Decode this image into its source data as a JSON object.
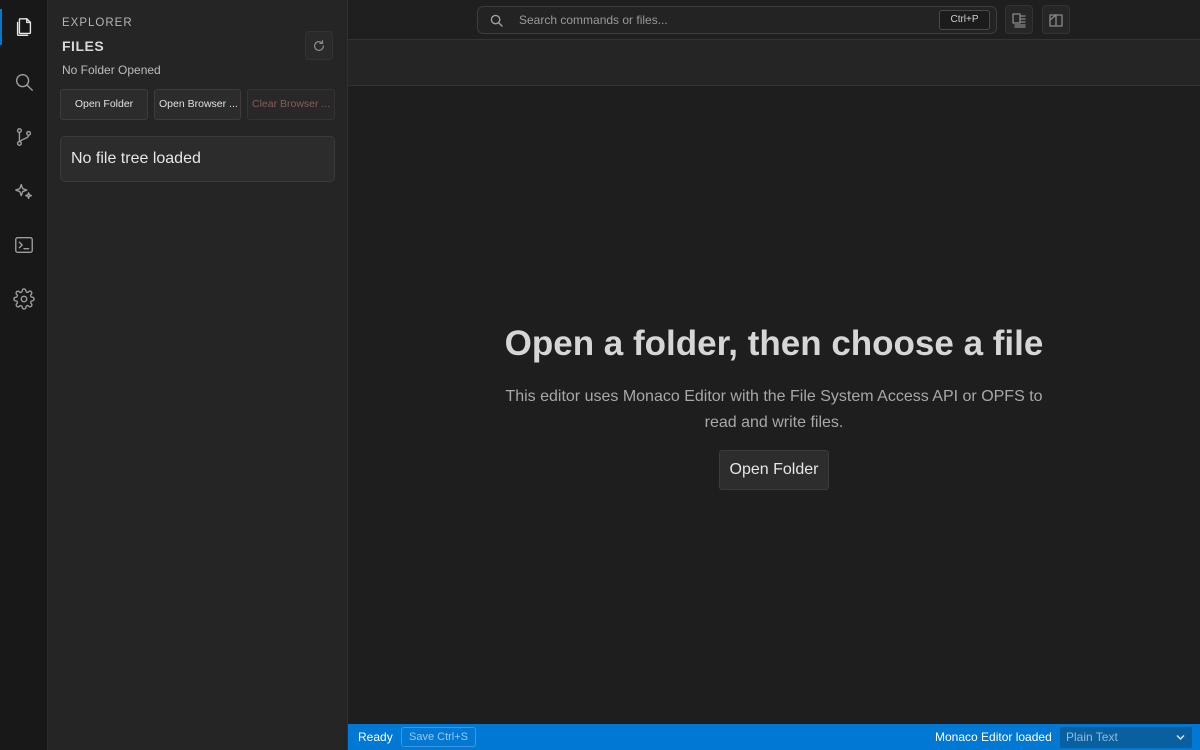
{
  "activity_bar": {
    "items": [
      {
        "name": "explorer",
        "icon": "files-icon",
        "active": true
      },
      {
        "name": "search",
        "icon": "search-icon",
        "active": false
      },
      {
        "name": "source-control",
        "icon": "source-control-icon",
        "active": false
      },
      {
        "name": "ai-assistant",
        "icon": "sparkle-icon",
        "active": false
      },
      {
        "name": "terminal",
        "icon": "terminal-icon",
        "active": false
      },
      {
        "name": "settings",
        "icon": "gear-icon",
        "active": false
      }
    ]
  },
  "sidebar": {
    "section_label": "EXPLORER",
    "title": "FILES",
    "subtitle": "No Folder Opened",
    "refresh_icon": "refresh-icon",
    "buttons": {
      "open_folder": "Open Folder",
      "open_browser": "Open Browser ...",
      "clear_browser": "Clear Browser ..."
    },
    "file_tree_empty": "No file tree loaded"
  },
  "topbar": {
    "search_placeholder": "Search commands or files...",
    "search_shortcut": "Ctrl+P",
    "icons": [
      "toggle-panel-icon",
      "split-layout-icon"
    ]
  },
  "editor": {
    "welcome_title": "Open a folder, then choose a file",
    "welcome_description": "This editor uses Monaco Editor with the File System Access API or OPFS to read and write files.",
    "open_folder_button": "Open Folder"
  },
  "statusbar": {
    "status": "Ready",
    "save_button": "Save Ctrl+S",
    "editor_status": "Monaco Editor loaded",
    "language_mode": "Plain Text"
  },
  "colors": {
    "accent": "#0078d4",
    "background": "#1e1e1e",
    "sidebar": "#252526"
  }
}
